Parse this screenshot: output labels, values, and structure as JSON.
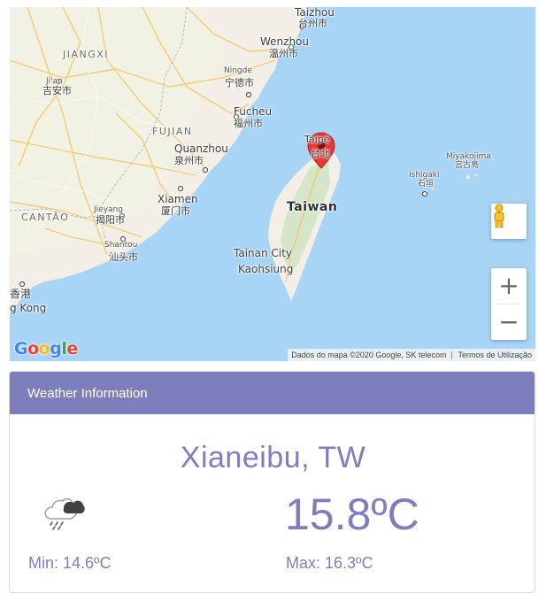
{
  "map": {
    "labels": {
      "taizhou": "Taizhou",
      "taizhou_cjk": "台州市",
      "wenzhou": "Wenzhou",
      "wenzhou_cjk": "温州市",
      "jiangxi": "JIANGXI",
      "jian": "Ji'an",
      "jian_cjk": "吉安市",
      "ningde": "Ningde",
      "ningde_cjk": "宁德市",
      "fucheu": "Fucheu",
      "fucheu_cjk": "福州市",
      "fujian": "FUJIAN",
      "taipei": "Taipé",
      "taipei_cjk": "台北",
      "miyakojima": "Miyakojima",
      "miyakojima_cjk": "宫古島",
      "quanzhou": "Quanzhou",
      "quanzhou_cjk": "泉州市",
      "ishigaki": "Ishigaki",
      "ishigaki_cjk": "石垣",
      "xiamen": "Xiamen",
      "xiamen_cjk": "厦门市",
      "taiwan": "Taiwan",
      "cantao": "CANTÃO",
      "jieyang": "Jieyang",
      "jieyang_cjk": "揭阳市",
      "shantou": "Shantou",
      "shantou_cjk": "汕头市",
      "tainan": "Tainan City",
      "kaohsiung": "Kaohsiung",
      "hongkong_cjk": "香港",
      "hongkong": "g Kong"
    },
    "google_logo": "Google",
    "attribution": "Dados do mapa ©2020 Google, SK telecom",
    "terms": "Termos de Utilização",
    "zoom_in": "+",
    "zoom_out": "−",
    "colors": {
      "water": "#a8d4f5",
      "land": "#f4efe6",
      "marker": "#e53935"
    }
  },
  "weather": {
    "header": "Weather Information",
    "city": "Xianeibu, TW",
    "temperature": "15.8ºC",
    "min": "Min: 14.6ºC",
    "max": "Max: 16.3ºC",
    "icon": "cloud-rain-icon",
    "accent_color": "#7e7ebd"
  }
}
